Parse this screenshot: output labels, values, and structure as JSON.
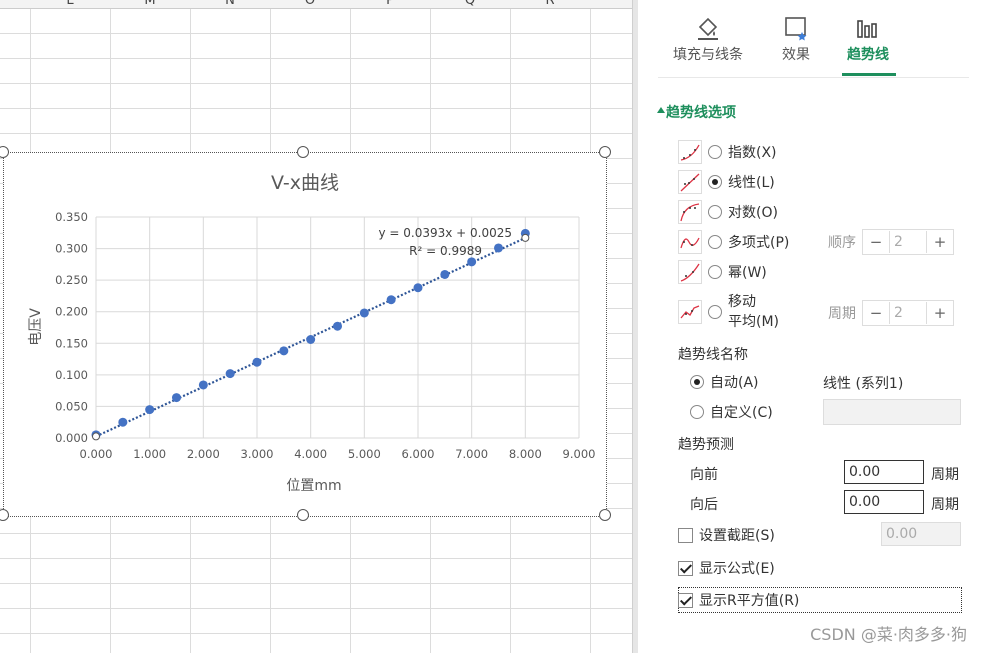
{
  "sheet": {
    "columns": [
      "L",
      "M",
      "N",
      "O",
      "P",
      "Q",
      "R"
    ]
  },
  "chart_data": {
    "type": "scatter",
    "title": "V-x曲线",
    "xlabel": "位置mm",
    "ylabel": "电压V",
    "xlim": [
      0,
      9
    ],
    "ylim": [
      0,
      0.35
    ],
    "x_ticks": [
      "0.000",
      "1.000",
      "2.000",
      "3.000",
      "4.000",
      "5.000",
      "6.000",
      "7.000",
      "8.000",
      "9.000"
    ],
    "y_ticks": [
      "0.000",
      "0.050",
      "0.100",
      "0.150",
      "0.200",
      "0.250",
      "0.300",
      "0.350"
    ],
    "grid": true,
    "series": [
      {
        "x": [
          0.0,
          0.5,
          1.0,
          1.5,
          2.0,
          2.5,
          3.0,
          3.5,
          4.0,
          4.5,
          5.0,
          5.5,
          6.0,
          6.5,
          7.0,
          7.5,
          8.0
        ],
        "y": [
          0.005,
          0.025,
          0.045,
          0.064,
          0.084,
          0.102,
          0.12,
          0.138,
          0.156,
          0.177,
          0.198,
          0.219,
          0.238,
          0.259,
          0.279,
          0.301,
          0.324
        ],
        "color": "#4472c4"
      }
    ],
    "trendline": {
      "type": "linear",
      "slope": 0.0393,
      "intercept": 0.0025,
      "equation": "y = 0.0393x + 0.0025",
      "r2": "R² = 0.9989",
      "color": "#2e5597"
    }
  },
  "panel": {
    "tabs": [
      {
        "label": "填充与线条",
        "icon": "paint-bucket-icon"
      },
      {
        "label": "效果",
        "icon": "effects-icon"
      },
      {
        "label": "趋势线",
        "icon": "bar-chart-icon",
        "active": true
      }
    ],
    "section_title": "趋势线选项",
    "types": [
      {
        "label": "指数(X)",
        "selected": false
      },
      {
        "label": "线性(L)",
        "selected": true
      },
      {
        "label": "对数(O)",
        "selected": false
      },
      {
        "label": "多项式(P)",
        "selected": false
      },
      {
        "label": "幂(W)",
        "selected": false
      },
      {
        "label": "移动",
        "label2": "平均(M)",
        "selected": false
      }
    ],
    "order": {
      "label": "顺序",
      "value": "2"
    },
    "period": {
      "label": "周期",
      "value": "2"
    },
    "stepper_minus": "−",
    "stepper_plus": "+",
    "name_heading": "趋势线名称",
    "name_auto_label": "自动(A)",
    "name_auto_value": "线性 (系列1)",
    "name_custom_label": "自定义(C)",
    "forecast_heading": "趋势预测",
    "forward_label": "向前",
    "forward_value": "0.00",
    "backward_label": "向后",
    "backward_value": "0.00",
    "period_unit": "周期",
    "intercept_label": "设置截距(S)",
    "intercept_value": "0.00",
    "show_equation_label": "显示公式(E)",
    "show_r2_label": "显示R平方值(R)",
    "accent": "#1e8f5d"
  },
  "watermark": "CSDN @菜·肉多多·狗"
}
